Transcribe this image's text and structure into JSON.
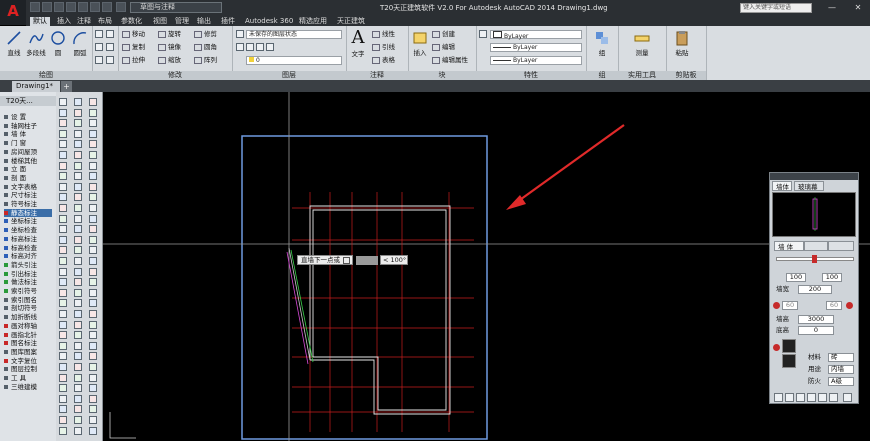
{
  "titlebar": {
    "title": "T20天正建筑软件 V2.0 For Autodesk AutoCAD 2014    Drawing1.dwg",
    "workspace": "草图与注释",
    "search_placeholder": "键入关键字或短语",
    "minimize": "—",
    "close": "✕"
  },
  "tabs": [
    "默认",
    "插入",
    "注释",
    "布局",
    "参数化",
    "视图",
    "管理",
    "输出",
    "插件",
    "Autodesk 360",
    "精选应用",
    "天正建筑"
  ],
  "ribbon": {
    "draw": {
      "label": "绘图",
      "line": "直线",
      "polyline": "多段线",
      "circle": "圆",
      "arc": "圆弧"
    },
    "modify": {
      "label": "修改",
      "move": "移动",
      "rotate": "旋转",
      "trim": "修剪",
      "copy": "复制",
      "mirror": "镜像",
      "fillet": "圆角",
      "stretch": "拉伸",
      "scale": "缩放",
      "array": "阵列"
    },
    "layers": {
      "label": "图层",
      "layer_state": "未保存的图层状态",
      "current_layer": "0"
    },
    "annotation": {
      "label": "注释",
      "text": "文字",
      "linear": "线性",
      "leader": "引线",
      "table": "表格"
    },
    "block": {
      "label": "块",
      "create": "创建",
      "edit": "编辑",
      "edit_attr": "编辑属性",
      "insert": "插入"
    },
    "properties": {
      "label": "特性",
      "color": "ByLayer",
      "linetype": "ByLayer",
      "lineweight": "ByLayer",
      "match": "特性匹配"
    },
    "groups": {
      "label": "组",
      "group": "组"
    },
    "utilities": {
      "label": "实用工具",
      "measure": "测量"
    },
    "clipboard": {
      "label": "剪贴板",
      "paste": "粘贴"
    }
  },
  "document": {
    "tab": "Drawing1*",
    "new_tab": "+"
  },
  "tpalette": {
    "title": "T20天...",
    "items": [
      "设    置",
      "轴网柱子",
      "墙    体",
      "门    窗",
      "房间屋顶",
      "楼梯其他",
      "立    面",
      "剖    面",
      "文字表格",
      "尺寸标注",
      "符号标注",
      "静态标注",
      "坐标标注",
      "坐标检查",
      "标高标注",
      "标高检查",
      "标高对齐",
      "箭头引注",
      "引出标注",
      "做法标注",
      "索引符号",
      "索引图名",
      "剖切符号",
      "加折断线",
      "画对称轴",
      "画指北针",
      "图名标注",
      "图库图案",
      "文字复位",
      "图层控制",
      "工    具",
      "三维建模"
    ]
  },
  "prompt": {
    "text": "直墙下一点或",
    "angle": "< 100°"
  },
  "wall_palette": {
    "tab_wall": "墙体",
    "tab_glass": "玻璃幕",
    "tab_attr": "墙    体",
    "left_width": "100",
    "right_width": "100",
    "width_label": "墙宽",
    "width_value": "200",
    "height_label": "墙高",
    "height_value": "3000",
    "base_label": "底高",
    "base_value": "0",
    "material_label": "材料",
    "material_value": "砖",
    "use_label": "用途",
    "use_value": "内墙",
    "fire_label": "防火",
    "fire_value": "A级",
    "offset_values": [
      "60",
      "60"
    ]
  },
  "colors": {
    "accent": "#3b6ea8",
    "wall": "#e8e8e8",
    "axis": "#d22222",
    "viewport": "#6f9ae0",
    "cursor": "#ff2a2a"
  }
}
